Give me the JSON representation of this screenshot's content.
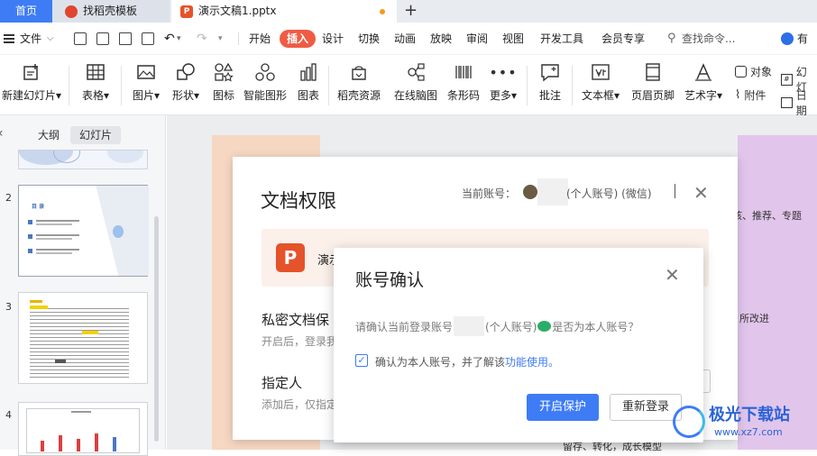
{
  "tabs": {
    "home": "首页",
    "templates": "找稻壳模板",
    "document": "演示文稿1.pptx",
    "new_tab": "+"
  },
  "menubar": {
    "file": "文件",
    "items": [
      "开始",
      "插入",
      "设计",
      "切换",
      "动画",
      "放映",
      "审阅",
      "视图",
      "开发工具",
      "会员专享"
    ],
    "search": "查找命令...",
    "right_cut": "有钱"
  },
  "toolbar": {
    "items": [
      "新建幻灯片",
      "表格",
      "图片",
      "形状",
      "图标",
      "智能图形",
      "图表",
      "稻壳资源",
      "在线脑图",
      "条形码",
      "更多",
      "批注",
      "文本框",
      "页眉页脚",
      "艺术字"
    ],
    "side_top": [
      "对象",
      "幻灯"
    ],
    "side_bottom": [
      "附件",
      "日期"
    ]
  },
  "leftpane": {
    "outline": "大纲",
    "slides": "幻灯片",
    "numbers": [
      "2",
      "3",
      "4"
    ],
    "thumb2_title": "目 录"
  },
  "canvas": {
    "right_texts": [
      "核、推荐、专题",
      "所改进",
      "留存、转化，成长模型"
    ]
  },
  "dialog_permission": {
    "title": "文档权限",
    "account_label": "当前账号：",
    "account_suffix": "(个人账号) (微信)",
    "file_name": "演示",
    "section1_title": "私密文档保",
    "section1_desc": "开启后，登录我",
    "section2_title": "指定人",
    "section2_desc": "添加后，仅指定"
  },
  "dialog_confirm": {
    "title": "账号确认",
    "question_prefix": "请确认当前登录账号",
    "question_type": "(个人账号)",
    "question_suffix": "是否为本人账号？",
    "checkbox_text": "确认为本人账号，并了解该",
    "checkbox_link": "功能使用。",
    "checked": true,
    "enable_button": "开启保护",
    "relogin_button": "重新登录"
  },
  "watermark": {
    "name": "极光下载站",
    "url": "www.xz7.com"
  },
  "colors": {
    "accent": "#3e7cf5",
    "insert_tab": "#f05b44",
    "wps_logo": "#e5532a",
    "slide_peach": "#f6d7c2",
    "slide_purple": "#e1c5eb"
  }
}
